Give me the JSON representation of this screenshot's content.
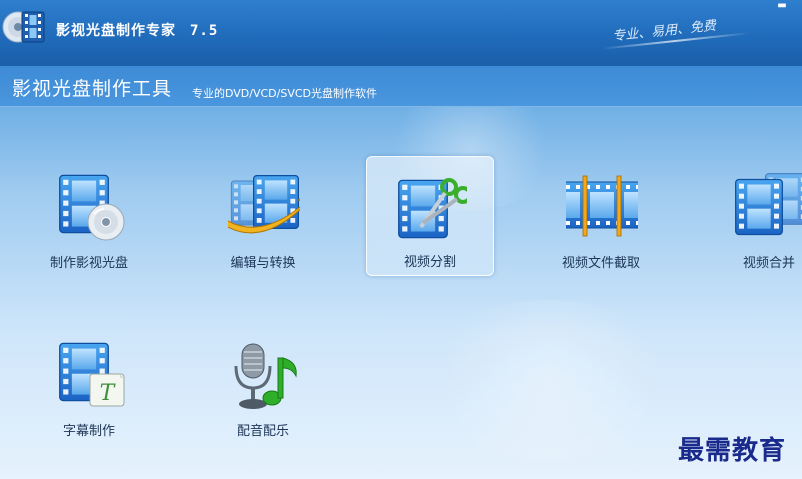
{
  "window": {
    "title": "影视光盘制作专家",
    "version": "7.5",
    "slogan": "专业、易用、免费",
    "minimize_glyph": "▬"
  },
  "header": {
    "title": "影视光盘制作工具",
    "description": "专业的DVD/VCD/SVCD光盘制作软件"
  },
  "tools": [
    {
      "label": "制作影视光盘",
      "icon": "film-disc-icon"
    },
    {
      "label": "编辑与转换",
      "icon": "film-arrow-icon"
    },
    {
      "label": "视频分割",
      "icon": "film-scissors-icon",
      "selected": true
    },
    {
      "label": "视频文件截取",
      "icon": "film-strip-trim-icon"
    },
    {
      "label": "视频合并",
      "icon": "film-merge-icon"
    },
    {
      "label": "字幕制作",
      "icon": "film-subtitle-icon"
    },
    {
      "label": "配音配乐",
      "icon": "microphone-music-icon"
    }
  ],
  "watermark": "最需教育",
  "colors": {
    "titlebar": "#1f6ab9",
    "accent_blue": "#2b78d0",
    "text": "#1b3556",
    "watermark": "#1a2a8c"
  }
}
